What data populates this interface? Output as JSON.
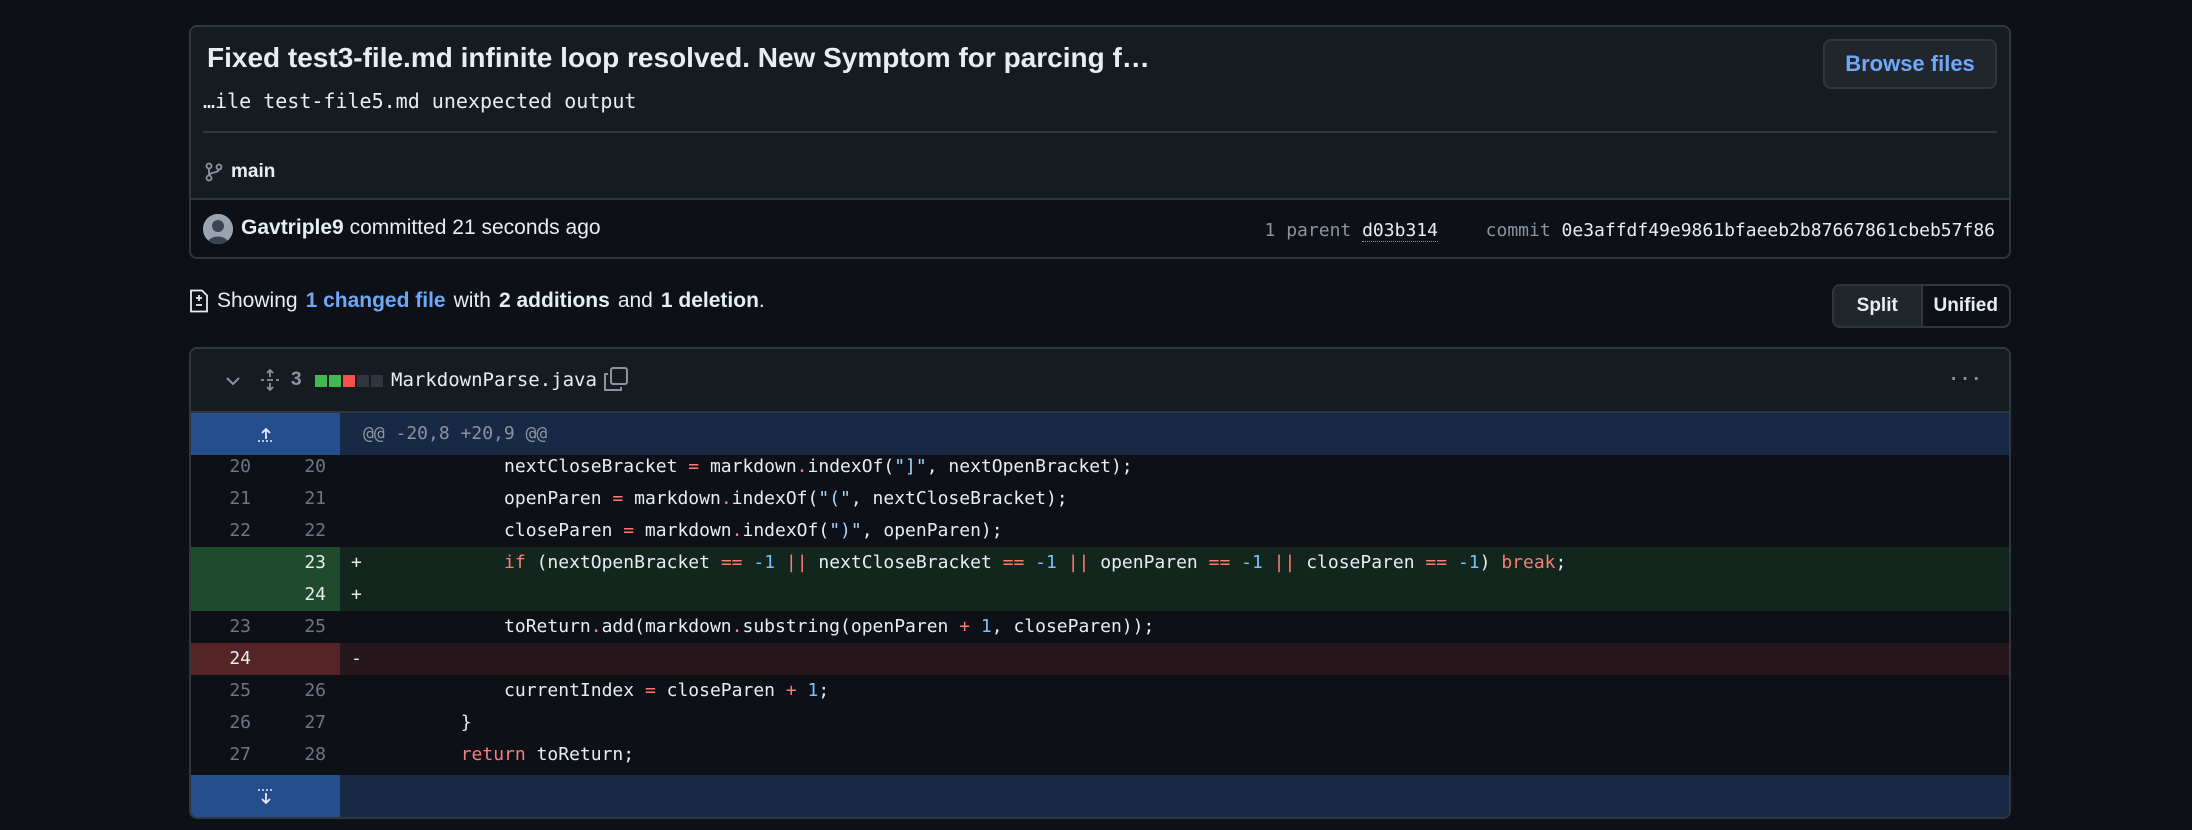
{
  "commit": {
    "title": "Fixed test3-file.md infinite loop resolved. New Symptom for parcing f…",
    "description": "…ile test-file5.md unexpected output",
    "browse_label": "Browse files",
    "branch": "main",
    "author": "Gavtriple9",
    "action": "committed",
    "time": "21 seconds ago",
    "parent_label": "1 parent",
    "parent_sha": "d03b314",
    "commit_label": "commit",
    "commit_sha": "0e3affdf49e9861bfaeeb2b87667861cbeb57f86"
  },
  "summary": {
    "prefix": "Showing",
    "changed": "1 changed file",
    "with": "with",
    "additions": "2 additions",
    "and": "and",
    "deletions": "1 deletion",
    "period": "."
  },
  "view": {
    "split": "Split",
    "unified": "Unified",
    "active": "Split"
  },
  "file": {
    "changes": "3",
    "name": "MarkdownParse.java",
    "diffstat": [
      "add",
      "add",
      "del",
      "neutral",
      "neutral"
    ],
    "hunk_header": "@@ -20,8 +20,9 @@",
    "lines": [
      {
        "type": "ctx",
        "old": "20",
        "new": "20",
        "sign": ""
      },
      {
        "type": "ctx",
        "old": "21",
        "new": "21",
        "sign": ""
      },
      {
        "type": "ctx",
        "old": "22",
        "new": "22",
        "sign": ""
      },
      {
        "type": "add",
        "old": "",
        "new": "23",
        "sign": "+"
      },
      {
        "type": "add",
        "old": "",
        "new": "24",
        "sign": "+"
      },
      {
        "type": "ctx",
        "old": "23",
        "new": "25",
        "sign": ""
      },
      {
        "type": "del",
        "old": "24",
        "new": "",
        "sign": "-"
      },
      {
        "type": "ctx",
        "old": "25",
        "new": "26",
        "sign": ""
      },
      {
        "type": "ctx",
        "old": "26",
        "new": "27",
        "sign": ""
      },
      {
        "type": "ctx",
        "old": "27",
        "new": "28",
        "sign": ""
      }
    ],
    "code": [
      "            nextCloseBracket = markdown.indexOf(\"]\", nextOpenBracket);",
      "            openParen = markdown.indexOf(\"(\", nextCloseBracket);",
      "            closeParen = markdown.indexOf(\")\", openParen);",
      "            if (nextOpenBracket == -1 || nextCloseBracket == -1 || openParen == -1 || closeParen == -1) break;",
      "",
      "            toReturn.add(markdown.substring(openParen + 1, closeParen));",
      "",
      "            currentIndex = closeParen + 1;",
      "        }",
      "        return toReturn;"
    ]
  },
  "colors": {
    "accent": "#6ea8f7",
    "add_bar": "#3fb950",
    "del_bar": "#f85149",
    "neutral_bar": "#30363d"
  }
}
